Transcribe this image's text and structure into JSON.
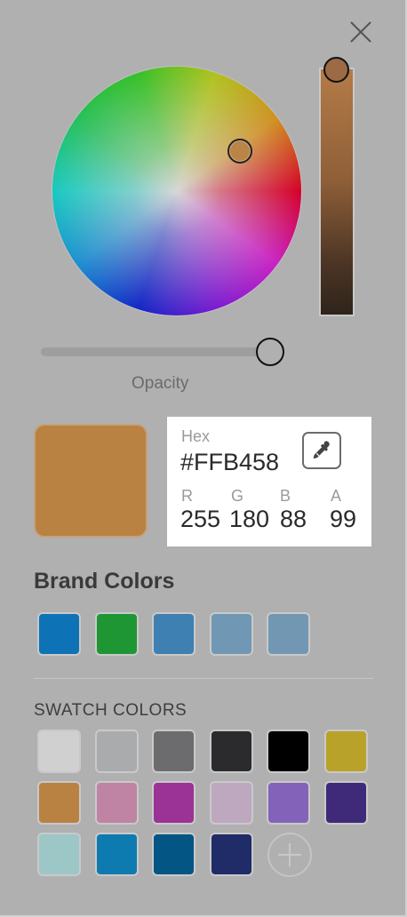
{
  "opacity_label": "Opacity",
  "hex": {
    "label": "Hex",
    "value": "#FFB458"
  },
  "channels": [
    {
      "label": "R",
      "value": "255"
    },
    {
      "label": "G",
      "value": "180"
    },
    {
      "label": "B",
      "value": "88"
    },
    {
      "label": "A",
      "value": "99"
    }
  ],
  "selected_color": "#B98243",
  "brand_title": "Brand Colors",
  "brand_colors": [
    "#0E72B6",
    "#1F9634",
    "#3E80B1",
    "#7098B4",
    "#7197B2"
  ],
  "swatch_title": "SWATCH COLORS",
  "swatch_colors": [
    "#D0D0D0",
    "#A9ABAC",
    "#6C6B6D",
    "#2B2B2D",
    "#000000",
    "#B9A22A",
    "#B98243",
    "#BF84A4",
    "#9B3397",
    "#BEA8C0",
    "#8363B9",
    "#3F2A7A",
    "#9DC6C7",
    "#0D7BB0",
    "#035584",
    "#1F2C68"
  ],
  "icons": {
    "close": "close-icon",
    "eyedropper": "eyedropper-icon",
    "add": "plus-icon"
  }
}
